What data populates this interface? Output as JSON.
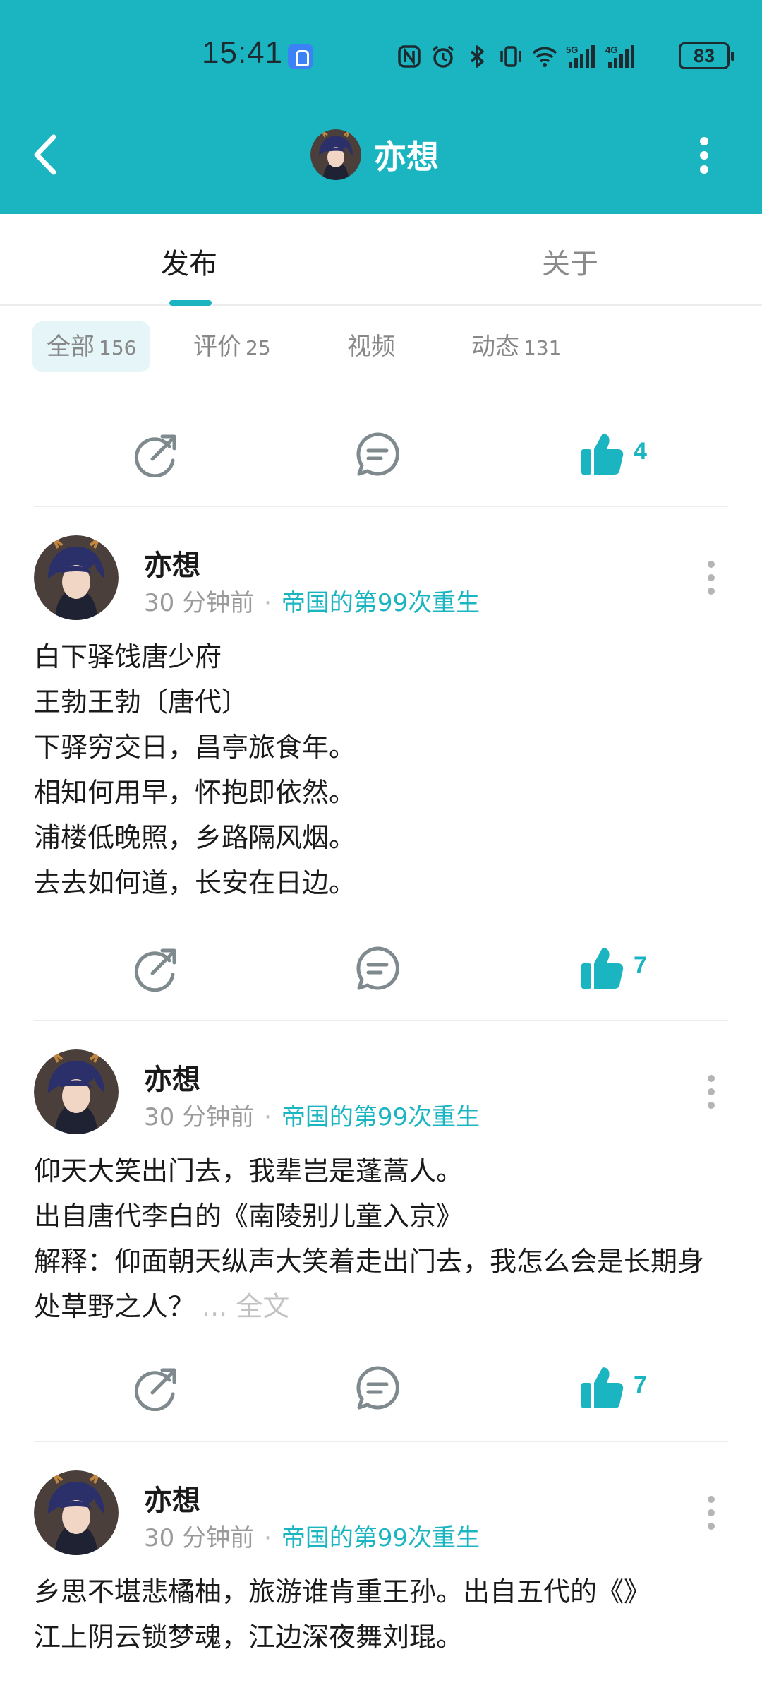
{
  "status_bar": {
    "time": "15:41",
    "battery": "83",
    "icons": [
      "app-badge-icon",
      "nfc-icon",
      "alarm-icon",
      "bluetooth-icon",
      "vibrate-icon",
      "wifi-icon",
      "signal-5g-icon",
      "signal-4g-icon",
      "battery-icon"
    ]
  },
  "header": {
    "title": "亦想",
    "accent_color": "#1ab5c1"
  },
  "tabs": [
    {
      "label": "发布",
      "active": true
    },
    {
      "label": "关于",
      "active": false
    }
  ],
  "filters": [
    {
      "label": "全部",
      "count": "156",
      "active": true
    },
    {
      "label": "评价",
      "count": "25",
      "active": false
    },
    {
      "label": "视频",
      "count": "",
      "active": false
    },
    {
      "label": "动态",
      "count": "131",
      "active": false
    }
  ],
  "top_partial": {
    "likes": "4"
  },
  "posts": [
    {
      "author": "亦想",
      "time": "30 分钟前",
      "source": "帝国的第99次重生",
      "lines": [
        "白下驿饯唐少府",
        "王勃王勃〔唐代〕",
        "下驿穷交日，昌亭旅食年。",
        "相知何用早，怀抱即依然。",
        "浦楼低晚照，乡路隔风烟。",
        "去去如何道，长安在日边。"
      ],
      "likes": "7"
    },
    {
      "author": "亦想",
      "time": "30 分钟前",
      "source": "帝国的第99次重生",
      "lines": [
        "仰天大笑出门去，我辈岂是蓬蒿人。",
        "出自唐代李白的《南陵别儿童入京》"
      ],
      "wrapped": "解释：仰面朝天纵声大笑着走出门去，我怎么会是长期身处草野之人？",
      "more": "... 全文",
      "likes": "7"
    },
    {
      "author": "亦想",
      "time": "30 分钟前",
      "source": "帝国的第99次重生",
      "lines": [
        "乡思不堪悲橘柚，旅游谁肯重王孙。出自五代的《》",
        "江上阴云锁梦魂，江边深夜舞刘琨。"
      ]
    }
  ]
}
